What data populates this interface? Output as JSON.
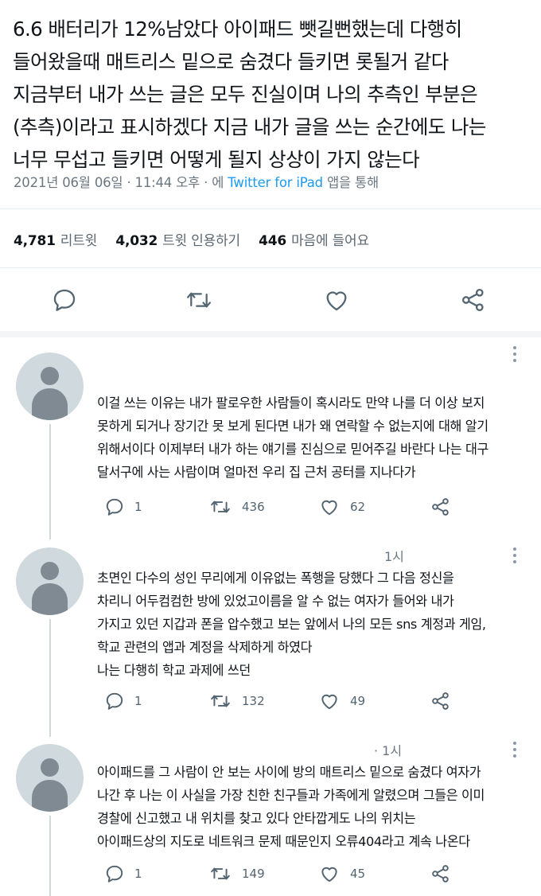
{
  "tweet": {
    "lines": [
      "6.6 배터리가 12%남았다 아이패드 뺏길뻔했는데 다행히",
      "들어왔을때 매트리스 밑으로 숨겼다 들키면 롯될거 같다",
      "지금부터 내가 쓰는 글은 모두 진실이며 나의 추측인 부분은",
      "(추측)이라고 표시하겠다 지금 내가 글을 쓰는 순간에도 나는",
      "너무 무섭고 들키면 어떻게 될지 상상이 가지 않는다"
    ],
    "meta_date": "2021년 06월 06일 · 11:44 오후 · 에",
    "meta_source": "Twitter for iPad",
    "meta_suffix": "앱을 통해"
  },
  "stats": {
    "retweets": "4,781",
    "retweets_label": "리트윗",
    "quotes": "4,032",
    "quotes_label": "트윗 인용하기",
    "likes": "446",
    "likes_label": "마음에 들어요"
  },
  "replies": [
    {
      "time": "",
      "lines": [
        "이걸 쓰는 이유는 내가 팔로우한 사람들이 혹시라도 만약 나를 더 이상 보지",
        "못하게 되거나 장기간 못 보게 된다면 내가 왜 연락할 수 없는지에 대해 알기",
        "위해서이다 이제부터 내가 하는 얘기를 진심으로 믿어주길 바란다 나는 대구",
        "달서구에 사는 사람이며 얼마전 우리 집 근처 공터를 지나다가"
      ],
      "replies": "1",
      "retweets": "436",
      "likes": "62"
    },
    {
      "time": "1시",
      "lines": [
        "초면인 다수의 성인 무리에게 이유없는 폭행을 당했다 그 다음 정신을",
        "차리니 어두컴컴한 방에 있었고이름을 알 수 없는 여자가 들어와 내가",
        "가지고 있던 지갑과 폰을 압수했고 보는 앞에서 나의 모든 sns 계정과 게임,",
        "학교 관련의 앱과 계정을 삭제하게 하였다",
        "나는 다행히 학교 과제에 쓰던"
      ],
      "replies": "1",
      "retweets": "132",
      "likes": "49"
    },
    {
      "time": "· 1시",
      "lines": [
        "아이패드를 그 사람이 안 보는 사이에 방의 매트리스 밑으로 숨겼다 여자가",
        "나간 후 나는 이 사실을 가장 친한 친구들과 가족에게 알렸으며 그들은 이미",
        "경찰에 신고했고 내 위치를 찾고 있다 안타깝게도 나의 위치는",
        "아이패드상의 지도로 네트워크 문제 때문인지 오류404라고 계속 나온다"
      ],
      "replies": "1",
      "retweets": "149",
      "likes": "45"
    }
  ],
  "colors": {
    "text": "#0f1419",
    "muted": "#6b7780",
    "link": "#1d9bf0",
    "avatar": "#cfd9de"
  }
}
